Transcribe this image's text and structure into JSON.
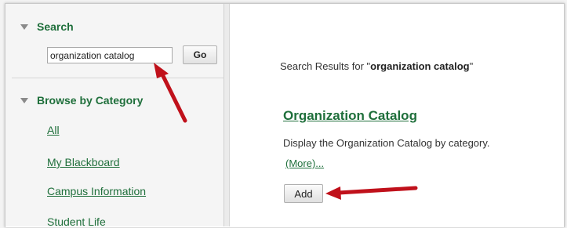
{
  "sidebar": {
    "search": {
      "title": "Search",
      "input_value": "organization catalog",
      "go_label": "Go"
    },
    "browse": {
      "title": "Browse by Category",
      "items": [
        {
          "label": "All"
        },
        {
          "label": "My Blackboard"
        },
        {
          "label": "Campus Information"
        },
        {
          "label": "Student Life"
        }
      ]
    }
  },
  "main": {
    "results_prefix": "Search Results for \"",
    "results_query": "organization catalog",
    "results_suffix": "\"",
    "result": {
      "title": "Organization Catalog",
      "description": "Display the Organization Catalog by category.",
      "more_label": "(More)...",
      "add_label": "Add"
    }
  },
  "colors": {
    "accent_green": "#1f6f3b",
    "annotation_arrow": "#c0111b"
  },
  "icons": {
    "collapse": "triangle-down-icon",
    "annotation": "red-arrow-icon"
  }
}
